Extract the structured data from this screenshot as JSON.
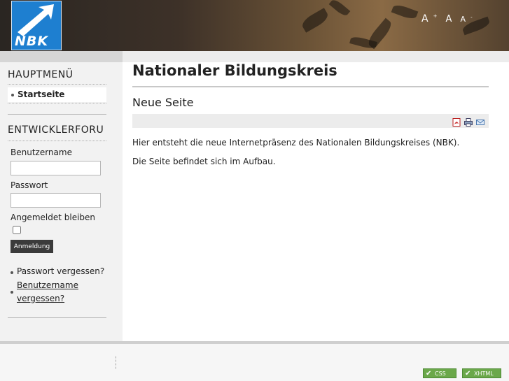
{
  "header": {
    "logo_text": "NBK",
    "font_controls": {
      "increase": "A",
      "increase_sup": "+",
      "reset": "A",
      "decrease": "A",
      "decrease_sup": "-"
    }
  },
  "sidebar": {
    "main_menu": {
      "title": "HAUPTMENÜ",
      "items": [
        {
          "label": "Startseite"
        }
      ]
    },
    "login": {
      "title": "ENTWICKLERFORU",
      "username_label": "Benutzername",
      "username_value": "",
      "password_label": "Passwort",
      "password_value": "",
      "remember_label": "Angemeldet bleiben",
      "remember_checked": false,
      "submit_label": "Anmeldung",
      "links": [
        {
          "label": "Passwort vergessen?"
        },
        {
          "label": "Benutzername",
          "label2": "vergessen?"
        }
      ]
    }
  },
  "main": {
    "page_title": "Nationaler Bildungskreis",
    "article": {
      "title": "Neue Seite",
      "icons": [
        "pdf-icon",
        "print-icon",
        "email-icon"
      ],
      "paragraphs": [
        "Hier entsteht die neue Internetpräsenz des Nationalen Bildungskreises (NBK).",
        "Die Seite befindet sich im Aufbau."
      ]
    }
  },
  "footer": {
    "badges": [
      {
        "label": "CSS"
      },
      {
        "label": "XHTML"
      }
    ]
  },
  "colors": {
    "logo_blue": "#1e7fd0",
    "badge_green": "#6ba84a"
  }
}
